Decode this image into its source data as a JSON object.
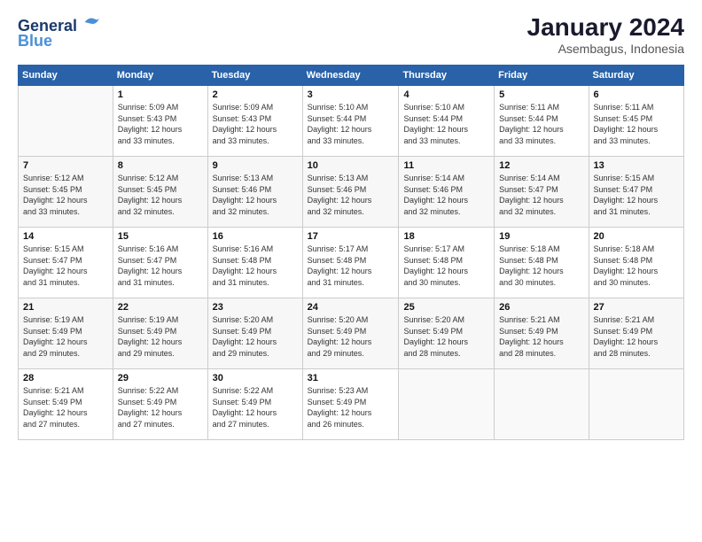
{
  "header": {
    "logo_line1": "General",
    "logo_line2": "Blue",
    "month_title": "January 2024",
    "subtitle": "Asembagus, Indonesia"
  },
  "weekdays": [
    "Sunday",
    "Monday",
    "Tuesday",
    "Wednesday",
    "Thursday",
    "Friday",
    "Saturday"
  ],
  "weeks": [
    [
      {
        "day": "",
        "info": ""
      },
      {
        "day": "1",
        "info": "Sunrise: 5:09 AM\nSunset: 5:43 PM\nDaylight: 12 hours\nand 33 minutes."
      },
      {
        "day": "2",
        "info": "Sunrise: 5:09 AM\nSunset: 5:43 PM\nDaylight: 12 hours\nand 33 minutes."
      },
      {
        "day": "3",
        "info": "Sunrise: 5:10 AM\nSunset: 5:44 PM\nDaylight: 12 hours\nand 33 minutes."
      },
      {
        "day": "4",
        "info": "Sunrise: 5:10 AM\nSunset: 5:44 PM\nDaylight: 12 hours\nand 33 minutes."
      },
      {
        "day": "5",
        "info": "Sunrise: 5:11 AM\nSunset: 5:44 PM\nDaylight: 12 hours\nand 33 minutes."
      },
      {
        "day": "6",
        "info": "Sunrise: 5:11 AM\nSunset: 5:45 PM\nDaylight: 12 hours\nand 33 minutes."
      }
    ],
    [
      {
        "day": "7",
        "info": "Sunrise: 5:12 AM\nSunset: 5:45 PM\nDaylight: 12 hours\nand 33 minutes."
      },
      {
        "day": "8",
        "info": "Sunrise: 5:12 AM\nSunset: 5:45 PM\nDaylight: 12 hours\nand 32 minutes."
      },
      {
        "day": "9",
        "info": "Sunrise: 5:13 AM\nSunset: 5:46 PM\nDaylight: 12 hours\nand 32 minutes."
      },
      {
        "day": "10",
        "info": "Sunrise: 5:13 AM\nSunset: 5:46 PM\nDaylight: 12 hours\nand 32 minutes."
      },
      {
        "day": "11",
        "info": "Sunrise: 5:14 AM\nSunset: 5:46 PM\nDaylight: 12 hours\nand 32 minutes."
      },
      {
        "day": "12",
        "info": "Sunrise: 5:14 AM\nSunset: 5:47 PM\nDaylight: 12 hours\nand 32 minutes."
      },
      {
        "day": "13",
        "info": "Sunrise: 5:15 AM\nSunset: 5:47 PM\nDaylight: 12 hours\nand 31 minutes."
      }
    ],
    [
      {
        "day": "14",
        "info": "Sunrise: 5:15 AM\nSunset: 5:47 PM\nDaylight: 12 hours\nand 31 minutes."
      },
      {
        "day": "15",
        "info": "Sunrise: 5:16 AM\nSunset: 5:47 PM\nDaylight: 12 hours\nand 31 minutes."
      },
      {
        "day": "16",
        "info": "Sunrise: 5:16 AM\nSunset: 5:48 PM\nDaylight: 12 hours\nand 31 minutes."
      },
      {
        "day": "17",
        "info": "Sunrise: 5:17 AM\nSunset: 5:48 PM\nDaylight: 12 hours\nand 31 minutes."
      },
      {
        "day": "18",
        "info": "Sunrise: 5:17 AM\nSunset: 5:48 PM\nDaylight: 12 hours\nand 30 minutes."
      },
      {
        "day": "19",
        "info": "Sunrise: 5:18 AM\nSunset: 5:48 PM\nDaylight: 12 hours\nand 30 minutes."
      },
      {
        "day": "20",
        "info": "Sunrise: 5:18 AM\nSunset: 5:48 PM\nDaylight: 12 hours\nand 30 minutes."
      }
    ],
    [
      {
        "day": "21",
        "info": "Sunrise: 5:19 AM\nSunset: 5:49 PM\nDaylight: 12 hours\nand 29 minutes."
      },
      {
        "day": "22",
        "info": "Sunrise: 5:19 AM\nSunset: 5:49 PM\nDaylight: 12 hours\nand 29 minutes."
      },
      {
        "day": "23",
        "info": "Sunrise: 5:20 AM\nSunset: 5:49 PM\nDaylight: 12 hours\nand 29 minutes."
      },
      {
        "day": "24",
        "info": "Sunrise: 5:20 AM\nSunset: 5:49 PM\nDaylight: 12 hours\nand 29 minutes."
      },
      {
        "day": "25",
        "info": "Sunrise: 5:20 AM\nSunset: 5:49 PM\nDaylight: 12 hours\nand 28 minutes."
      },
      {
        "day": "26",
        "info": "Sunrise: 5:21 AM\nSunset: 5:49 PM\nDaylight: 12 hours\nand 28 minutes."
      },
      {
        "day": "27",
        "info": "Sunrise: 5:21 AM\nSunset: 5:49 PM\nDaylight: 12 hours\nand 28 minutes."
      }
    ],
    [
      {
        "day": "28",
        "info": "Sunrise: 5:21 AM\nSunset: 5:49 PM\nDaylight: 12 hours\nand 27 minutes."
      },
      {
        "day": "29",
        "info": "Sunrise: 5:22 AM\nSunset: 5:49 PM\nDaylight: 12 hours\nand 27 minutes."
      },
      {
        "day": "30",
        "info": "Sunrise: 5:22 AM\nSunset: 5:49 PM\nDaylight: 12 hours\nand 27 minutes."
      },
      {
        "day": "31",
        "info": "Sunrise: 5:23 AM\nSunset: 5:49 PM\nDaylight: 12 hours\nand 26 minutes."
      },
      {
        "day": "",
        "info": ""
      },
      {
        "day": "",
        "info": ""
      },
      {
        "day": "",
        "info": ""
      }
    ]
  ]
}
